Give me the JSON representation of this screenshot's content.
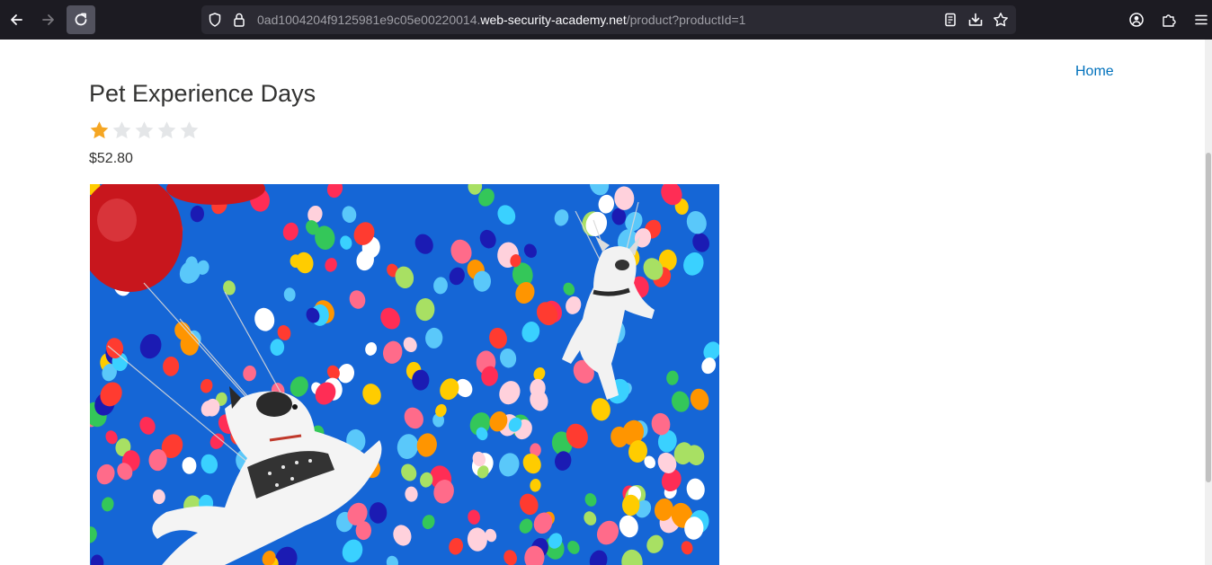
{
  "browser": {
    "url_prefix": "0ad1004204f9125981e9c05e00220014.",
    "url_host": "web-security-academy.net",
    "url_path": "/product?productId=1"
  },
  "nav": {
    "home_label": "Home"
  },
  "product": {
    "title": "Pet Experience Days",
    "rating": 1,
    "rating_max": 5,
    "price": "$52.80",
    "image_icon": "balloons-dogs-photo"
  },
  "colors": {
    "link": "#0071bc",
    "star_filled": "#f5a623",
    "star_empty": "#e4e6e8",
    "sky": "#1566d6"
  }
}
